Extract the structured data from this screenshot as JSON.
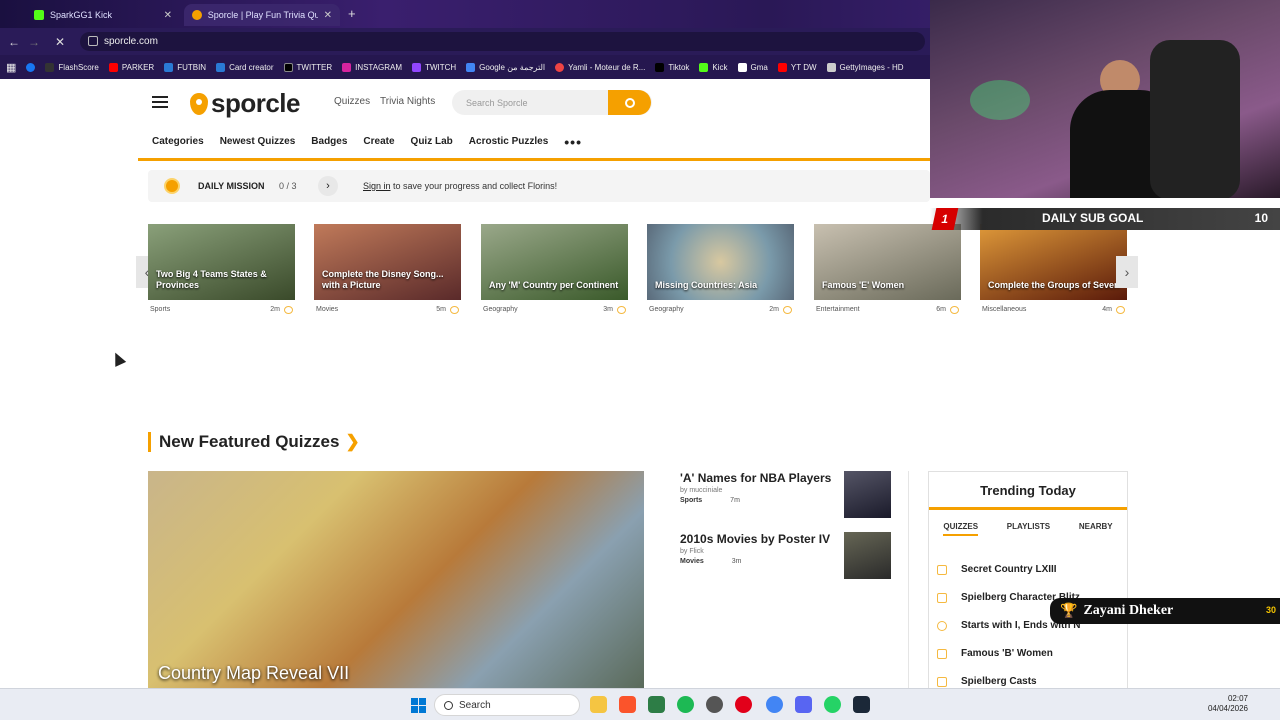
{
  "browser": {
    "tabs": [
      {
        "title": "SparkGG1 Kick",
        "active": false
      },
      {
        "title": "Sporcle | Play Fun Trivia Quizzes",
        "active": true
      }
    ],
    "new_tab": "+",
    "url": "sporcle.com",
    "bookmarks": [
      "FlashScore",
      "PARKER",
      "FUTBIN",
      "Card creator",
      "TWITTER",
      "INSTAGRAM",
      "TWITCH",
      "Google الترجمة من",
      "Yamli - Moteur de R...",
      "Tiktok",
      "Kick",
      "Gma",
      "YT DW",
      "GettyImages - HD"
    ]
  },
  "header": {
    "logo": "sporcle",
    "links": [
      "Quizzes",
      "Trivia Nights"
    ],
    "search_placeholder": "Search Sporcle"
  },
  "catnav": [
    "Categories",
    "Newest Quizzes",
    "Badges",
    "Create",
    "Quiz Lab",
    "Acrostic Puzzles"
  ],
  "mission": {
    "title": "DAILY MISSION",
    "count": "0 / 3",
    "signin": "Sign in",
    "text": "to save your progress and collect Florins!"
  },
  "carousel": [
    {
      "title": "Two Big 4 Teams States & Provinces",
      "cat": "Sports",
      "time": "2m",
      "color": "#5a6a4a"
    },
    {
      "title": "Complete the Disney Song... with a Picture",
      "cat": "Movies",
      "time": "5m",
      "color": "#8a4a3a"
    },
    {
      "title": "Any 'M' Country per Continent",
      "cat": "Geography",
      "time": "3m",
      "color": "#5a7a3a"
    },
    {
      "title": "Missing Countries: Asia",
      "cat": "Geography",
      "time": "2m",
      "color": "#7a8a9a"
    },
    {
      "title": "Famous 'E' Women",
      "cat": "Entertainment",
      "time": "6m",
      "color": "#8a8a7a"
    },
    {
      "title": "Complete the Groups of Seven",
      "cat": "Miscellaneous",
      "time": "4m",
      "color": "#8a4a1a"
    }
  ],
  "featured": {
    "section_title": "New Featured Quizzes",
    "main_title": "Country Map Reveal VII",
    "side": [
      {
        "title": "'A' Names for NBA Players",
        "by": "by mucciniale",
        "cat": "Sports",
        "time": "7m"
      },
      {
        "title": "2010s Movies by Poster IV",
        "by": "by Flick",
        "cat": "Movies",
        "time": "3m"
      }
    ]
  },
  "trending": {
    "title": "Trending Today",
    "tabs": [
      "QUIZZES",
      "PLAYLISTS",
      "NEARBY"
    ],
    "items": [
      "Secret Country LXIII",
      "Spielberg Character Blitz",
      "Starts with I, Ends with N",
      "Famous 'B' Women",
      "Spielberg Casts"
    ]
  },
  "stream": {
    "sub_goal_current": "1",
    "sub_goal_label": "DAILY SUB GOAL",
    "sub_goal_target": "10",
    "alert_name": "Zayani Dheker",
    "alert_count": "30"
  },
  "taskbar": {
    "search": "Search",
    "time": "02:07",
    "date": "04/04/2026"
  }
}
